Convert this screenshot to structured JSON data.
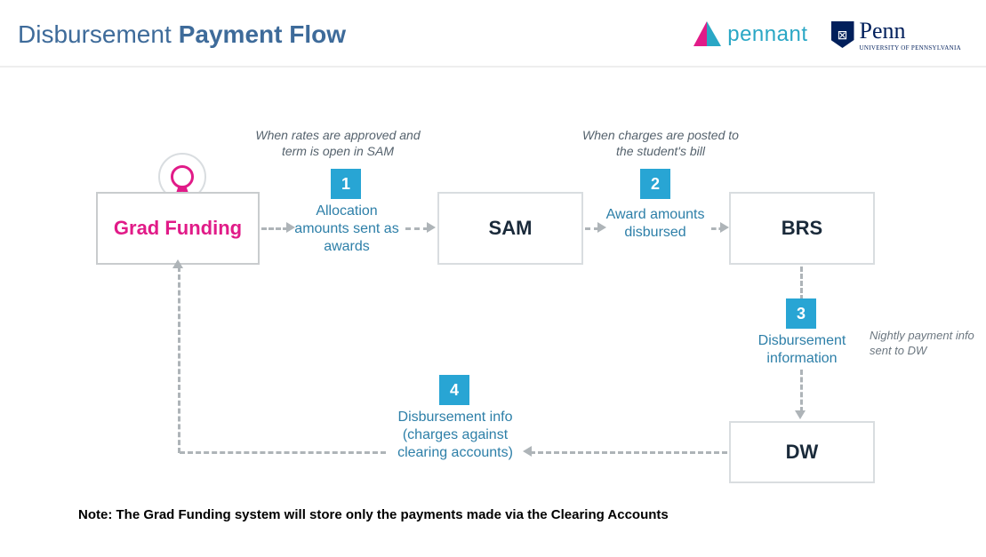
{
  "header": {
    "title_light": "Disbursement",
    "title_bold": "Payment Flow",
    "pennant_label": "pennant",
    "penn_label": "Penn",
    "penn_sub": "University of Pennsylvania"
  },
  "nodes": {
    "grad_funding": "Grad Funding",
    "sam": "SAM",
    "brs": "BRS",
    "dw": "DW"
  },
  "steps": {
    "s1": {
      "num": "1",
      "caption": "Allocation amounts sent as awards",
      "top_note": "When rates are approved and term is open in SAM"
    },
    "s2": {
      "num": "2",
      "caption": "Award amounts disbursed",
      "top_note": "When charges are posted to the student's bill"
    },
    "s3": {
      "num": "3",
      "caption": "Disbursement information",
      "side_note": "Nightly payment info sent to DW"
    },
    "s4": {
      "num": "4",
      "caption": "Disbursement info (charges against clearing accounts)"
    }
  },
  "footer": "Note: The Grad Funding system will store only the payments made via the Clearing Accounts"
}
